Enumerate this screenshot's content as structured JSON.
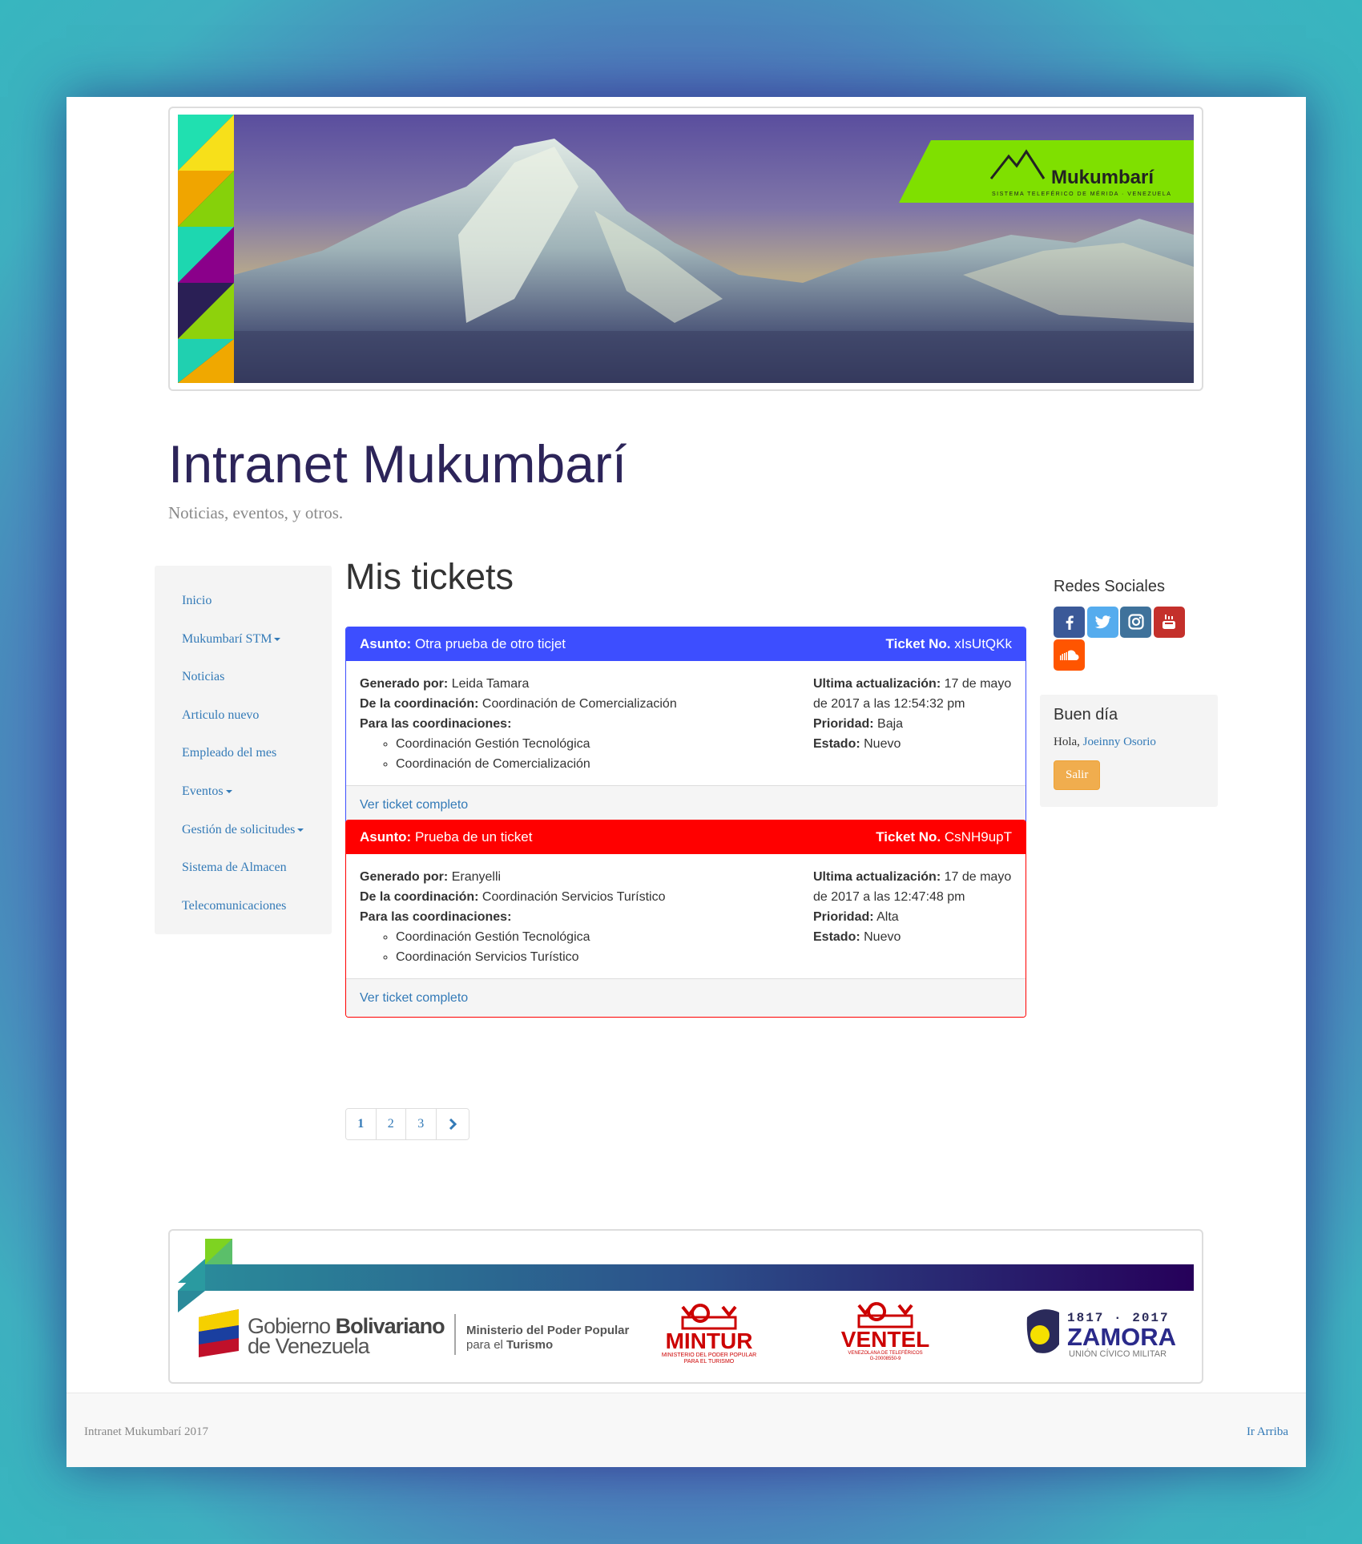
{
  "banner": {
    "brand_name": "Mukumbarí",
    "brand_sub": "SISTEMA TELEFÉRICO DE MÉRIDA · VENEZUELA"
  },
  "site": {
    "title": "Intranet Mukumbarí",
    "tagline": "Noticias, eventos, y otros."
  },
  "nav": {
    "items": [
      {
        "label": "Inicio",
        "dropdown": false
      },
      {
        "label": "Mukumbarí STM",
        "dropdown": true
      },
      {
        "label": "Noticias",
        "dropdown": false
      },
      {
        "label": "Articulo nuevo",
        "dropdown": false
      },
      {
        "label": "Empleado del mes",
        "dropdown": false
      },
      {
        "label": "Eventos",
        "dropdown": true
      },
      {
        "label": "Gestión de solicitudes",
        "dropdown": true
      },
      {
        "label": "Sistema de Almacen",
        "dropdown": false
      },
      {
        "label": "Telecomunicaciones",
        "dropdown": false
      }
    ]
  },
  "main": {
    "title": "Mis tickets",
    "labels": {
      "subject": "Asunto:",
      "ticket_no": "Ticket No.",
      "generated_by": "Generado por:",
      "from_coord": "De la coordinación:",
      "to_coords": "Para las coordinaciones:",
      "last_update": "Ultima actualización:",
      "priority": "Prioridad:",
      "status": "Estado:",
      "view_full": "Ver ticket completo"
    },
    "tickets": [
      {
        "subject": "Otra prueba de otro ticjet",
        "ticket_no": "xIsUtQKk",
        "generated_by": "Leida Tamara",
        "from_coord": "Coordinación de Comercialización",
        "to_coords": [
          "Coordinación Gestión Tecnológica",
          "Coordinación de Comercialización"
        ],
        "last_update": "17 de mayo de 2017 a las 12:54:32 pm",
        "priority": "Baja",
        "status": "Nuevo",
        "color": "#3d4eff"
      },
      {
        "subject": "Prueba de un ticket",
        "ticket_no": "CsNH9upT",
        "generated_by": "Eranyelli",
        "from_coord": "Coordinación Servicios Turístico",
        "to_coords": [
          "Coordinación Gestión Tecnológica",
          "Coordinación Servicios Turístico"
        ],
        "last_update": "17 de mayo de 2017 a las 12:47:48 pm",
        "priority": "Alta",
        "status": "Nuevo",
        "color": "#ff0000"
      }
    ],
    "pagination": {
      "pages": [
        "1",
        "2",
        "3"
      ],
      "current": "1"
    }
  },
  "sidebar": {
    "social_title": "Redes Sociales",
    "social": [
      {
        "name": "facebook-icon",
        "color": "#3b5998"
      },
      {
        "name": "twitter-icon",
        "color": "#55acee"
      },
      {
        "name": "instagram-icon",
        "color": "#3f729b"
      },
      {
        "name": "youtube-icon",
        "color": "#c4302b"
      },
      {
        "name": "soundcloud-icon",
        "color": "#ff5500"
      }
    ],
    "greeting": {
      "title": "Buen día",
      "hello": "Hola,",
      "user": "Joeinny Osorio",
      "logout": "Salir"
    }
  },
  "footer_logos": {
    "gob_line1_a": "Gobierno ",
    "gob_line1_b": "Bolivariano",
    "gob_line2": "de Venezuela",
    "ministry_line1": "Ministerio del Poder Popular",
    "ministry_line2_a": "para el ",
    "ministry_line2_b": "Turismo",
    "mintur": "MINTUR",
    "mintur_sub1": "MINISTERIO DEL PODER POPULAR",
    "mintur_sub2": "PARA EL TURISMO",
    "ventel": "VENTEL",
    "ventel_sub1": "VENEZOLANA DE TELEFÉRICOS",
    "ventel_sub2": "G-20008550-9",
    "zamora_years": "1817 · 2017",
    "zamora": "ZAMORA",
    "zamora_sub": "UNIÓN CÍVICO MILITAR"
  },
  "footer": {
    "copyright": "Intranet Mukumbarí 2017",
    "back_to_top": "Ir Arriba"
  }
}
